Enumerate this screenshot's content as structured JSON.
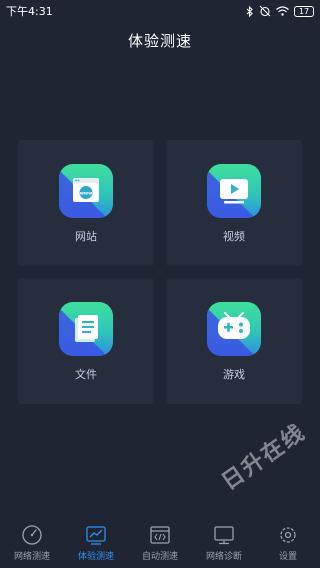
{
  "status_bar": {
    "time": "下午4:31",
    "battery": "17",
    "icons": [
      "bluetooth-icon",
      "alarm-off-icon",
      "wifi-icon",
      "battery-icon"
    ]
  },
  "header": {
    "title": "体验测速"
  },
  "tiles": [
    {
      "label": "网站",
      "icon": "website-icon"
    },
    {
      "label": "视频",
      "icon": "video-icon"
    },
    {
      "label": "文件",
      "icon": "file-icon"
    },
    {
      "label": "游戏",
      "icon": "gamepad-icon"
    }
  ],
  "bottom_nav": {
    "items": [
      {
        "label": "网络测速",
        "icon": "speedometer-icon",
        "active": false
      },
      {
        "label": "体验测速",
        "icon": "trend-chart-icon",
        "active": true
      },
      {
        "label": "自动测速",
        "icon": "code-window-icon",
        "active": false
      },
      {
        "label": "网络诊断",
        "icon": "monitor-icon",
        "active": false
      },
      {
        "label": "设置",
        "icon": "settings-icon",
        "active": false
      }
    ]
  },
  "watermark": {
    "text": "日升在线"
  },
  "colors": {
    "background": "#1f2533",
    "tile": "#262d3d",
    "accent": "#2f8ff0",
    "icon_gradient_top": "#3fdf9c",
    "icon_gradient_bottom": "#2e8fe0"
  }
}
